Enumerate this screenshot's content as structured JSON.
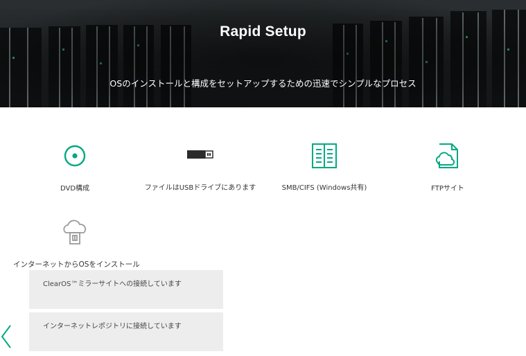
{
  "hero": {
    "title": "Rapid Setup",
    "subtitle": "OSのインストールと構成をセットアップするための迅速でシンプルなプロセス"
  },
  "options": [
    {
      "icon": "disc-icon",
      "label": "DVD構成"
    },
    {
      "icon": "usb-drive-icon",
      "label": "ファイルはUSBドライブにあります"
    },
    {
      "icon": "network-share-icon",
      "label": "SMB/CIFS (Windows共有)"
    },
    {
      "icon": "ftp-cloud-icon",
      "label": "FTPサイト"
    },
    {
      "icon": "internet-install-icon",
      "label": "インターネットからOSをインストール"
    }
  ],
  "status_messages": [
    "ClearOS™ミラーサイトへの接続しています",
    "インターネットレポジトリに接続しています"
  ],
  "nav": {
    "back_icon": "chevron-left-icon"
  },
  "colors": {
    "accent": "#01a982",
    "banner": "#1c1f21",
    "status_bg": "#ededed"
  }
}
